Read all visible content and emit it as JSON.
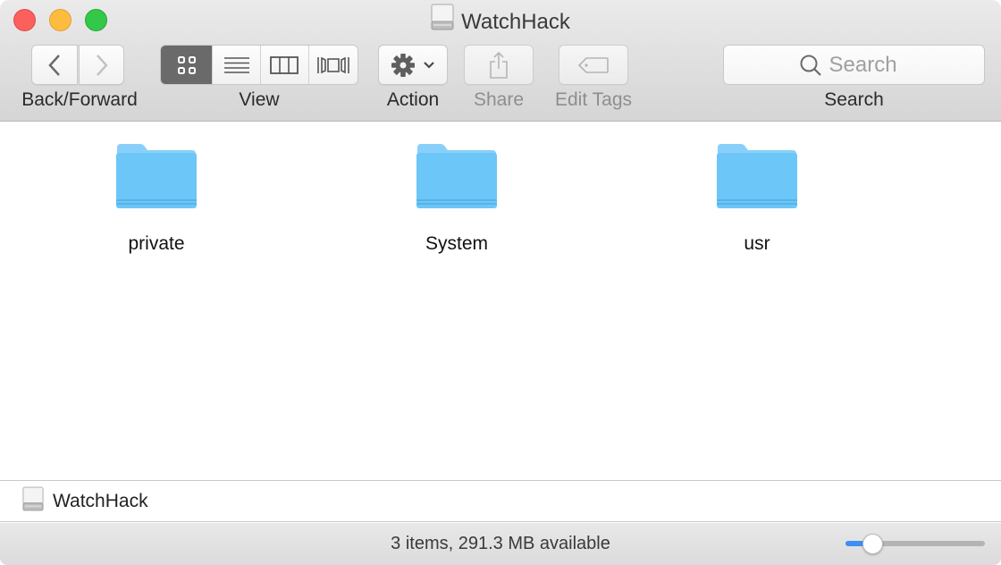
{
  "window": {
    "title": "WatchHack",
    "title_icon": "drive-icon"
  },
  "toolbar": {
    "back_forward_label": "Back/Forward",
    "back_icon": "chevron-left-icon",
    "forward_icon": "chevron-right-icon",
    "view_label": "View",
    "view_modes": [
      {
        "name": "icon-view",
        "icon": "grid-icon",
        "active": true
      },
      {
        "name": "list-view",
        "icon": "list-icon",
        "active": false
      },
      {
        "name": "column-view",
        "icon": "columns-icon",
        "active": false
      },
      {
        "name": "cover-flow-view",
        "icon": "cover-flow-icon",
        "active": false
      }
    ],
    "action_label": "Action",
    "share_label": "Share",
    "edit_tags_label": "Edit Tags",
    "search_label": "Search",
    "search_placeholder": "Search",
    "search_value": ""
  },
  "content": {
    "items": [
      {
        "name": "private",
        "icon": "folder-icon"
      },
      {
        "name": "System",
        "icon": "folder-icon"
      },
      {
        "name": "usr",
        "icon": "folder-icon"
      }
    ]
  },
  "pathbar": {
    "name": "WatchHack",
    "icon": "drive-icon"
  },
  "statusbar": {
    "status": "3 items, 291.3 MB available",
    "icon_size_slider": 0.19
  },
  "colors": {
    "folder": "#6cc6f7",
    "accent": "#3d8ff5",
    "close": "#fc605c",
    "minimize": "#fdbc40",
    "maximize": "#34c84a"
  }
}
